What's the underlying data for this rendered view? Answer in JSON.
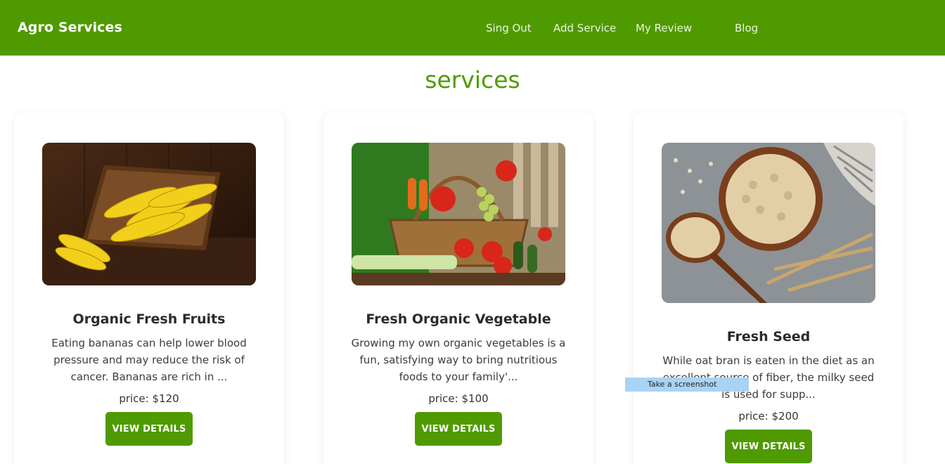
{
  "navbar": {
    "brand": "Agro Services",
    "links": [
      {
        "label": "Sing Out"
      },
      {
        "label": "Add Service"
      },
      {
        "label": "My Review"
      },
      {
        "label": "Blog"
      }
    ],
    "background": "#4f9a00"
  },
  "section": {
    "title": "services"
  },
  "cards": [
    {
      "image": "bananas-crate-image",
      "title": "Organic Fresh Fruits",
      "description": "Eating bananas can help lower blood pressure and may reduce the risk of cancer. Bananas are rich in ...",
      "price": "price: $120",
      "button": "VIEW DETAILS"
    },
    {
      "image": "vegetable-basket-image",
      "title": "Fresh Organic Vegetable",
      "description": "Growing my own organic vegetables is a fun, satisfying way to bring nutritious foods to your family'...",
      "price": "price: $100",
      "button": "VIEW DETAILS"
    },
    {
      "image": "oat-seeds-bowl-image",
      "title": "Fresh Seed",
      "description": "While oat bran is eaten in the diet as an excellent source of fiber, the milky seed is used for supp...",
      "price": "price: $200",
      "button": "VIEW DETAILS"
    }
  ],
  "tooltip": {
    "text": "Take a screenshot"
  },
  "colors": {
    "accent": "#4f9a00",
    "tooltip_bg": "#a9d3f5"
  }
}
